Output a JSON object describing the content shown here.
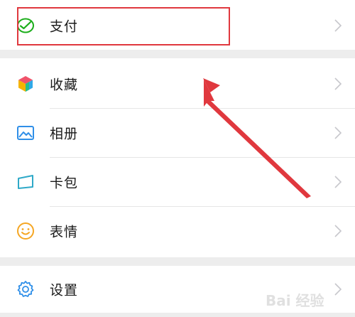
{
  "menu": {
    "pay": {
      "label": "支付",
      "icon": "wechat-pay-icon"
    },
    "favorites": {
      "label": "收藏",
      "icon": "favorites-cube-icon"
    },
    "album": {
      "label": "相册",
      "icon": "photo-album-icon"
    },
    "cards": {
      "label": "卡包",
      "icon": "card-wallet-icon"
    },
    "stickers": {
      "label": "表情",
      "icon": "smiley-icon"
    },
    "settings": {
      "label": "设置",
      "icon": "gear-icon"
    }
  },
  "colors": {
    "highlight": "#e0383e",
    "pay_green": "#1aad19",
    "album_blue": "#2f8fe8",
    "settings_blue": "#2f8fe8",
    "smiley_orange": "#f5a623",
    "chevron": "#c7c7cc"
  },
  "watermark": {
    "text": "Bai 经验",
    "icon": "baidu-paw-logo"
  }
}
